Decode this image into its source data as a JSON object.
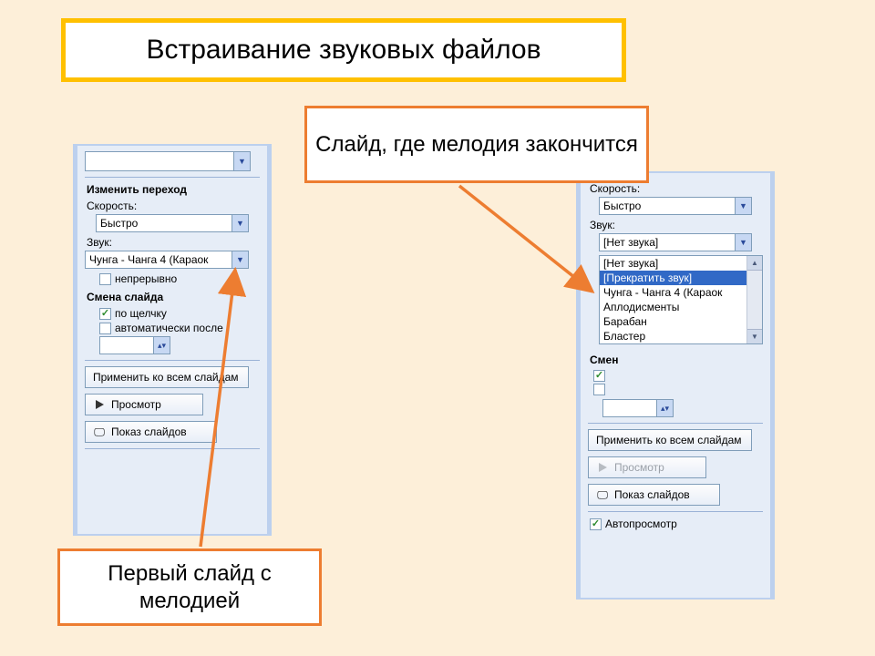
{
  "title": "Встраивание звуковых файлов",
  "callouts": {
    "top": "Слайд, где мелодия закончится",
    "bottom": "Первый слайд с мелодией"
  },
  "left_panel": {
    "section1": "Изменить переход",
    "speed_label": "Скорость:",
    "speed_value": "Быстро",
    "sound_label": "Звук:",
    "sound_value": "Чунга - Чанга 4 (Караок",
    "loop_label": "непрерывно",
    "section2": "Смена слайда",
    "on_click": "по щелчку",
    "auto_after": "автоматически после",
    "apply_all": "Применить ко всем слайдам",
    "preview": "Просмотр",
    "slideshow": "Показ слайдов"
  },
  "right_panel": {
    "speed_label": "Скорость:",
    "speed_value": "Быстро",
    "sound_label": "Звук:",
    "sound_value": "[Нет звука]",
    "options": [
      "[Нет звука]",
      "[Прекратить звук]",
      "Чунга - Чанга 4 (Караок",
      "Аплодисменты",
      "Барабан",
      "Бластер"
    ],
    "selected_index": 1,
    "section2_short": "Смен",
    "apply_all": "Применить ко всем слайдам",
    "preview": "Просмотр",
    "slideshow": "Показ слайдов",
    "autopreview": "Автопросмотр"
  }
}
